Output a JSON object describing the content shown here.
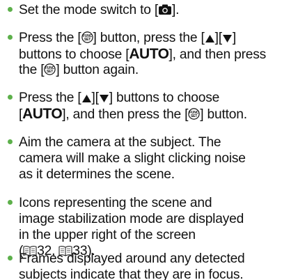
{
  "items": [
    {
      "lines": [
        [
          "Set the mode switch to [",
          "{camera-icon}",
          "]."
        ]
      ]
    },
    {
      "lines": [
        [
          "Press the [",
          "{func-set-icon}",
          "] button, press the [",
          "{up-triangle-icon}",
          "][",
          "{down-triangle-icon}",
          "]"
        ],
        [
          "buttons to choose ",
          "{AUTO}",
          ", and then press"
        ],
        [
          "the [",
          "{func-set-icon}",
          "] button again."
        ]
      ]
    },
    {
      "lines": [
        [
          "Press the [",
          "{up-triangle-icon}",
          "][",
          "{down-triangle-icon}",
          "] buttons to choose"
        ],
        [
          "{AUTO}",
          ", and then press the [",
          "{func-set-icon}",
          "] button."
        ]
      ]
    },
    {
      "lines": [
        [
          "Aim the camera at the subject. The"
        ],
        [
          "camera will make a slight clicking noise"
        ],
        [
          "as it determines the scene."
        ]
      ]
    },
    {
      "lines": [
        [
          "Icons representing the scene and"
        ],
        [
          "image stabilization mode are displayed"
        ],
        [
          "in the upper right of the screen"
        ],
        [
          "(",
          "{book-icon}",
          "32, ",
          "{book-icon}",
          "33)."
        ]
      ]
    },
    {
      "lines": [
        [
          "Frames displayed around any detected"
        ],
        [
          "subjects indicate that they are in focus."
        ]
      ]
    }
  ],
  "auto_text": "AUTO",
  "colors": {
    "bullet": "#5db04b",
    "text": "#111111"
  }
}
